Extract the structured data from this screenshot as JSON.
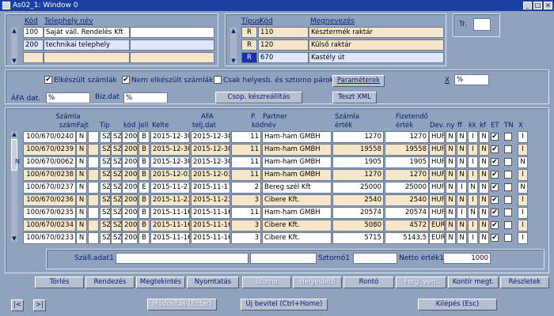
{
  "window": {
    "title": "As02_1: Window 0"
  },
  "telephely": {
    "headers": {
      "kod": "Kód",
      "nev": "Telephely név"
    },
    "rows": [
      {
        "kod": "100",
        "nev": "Saját váll. Rendelés Kft",
        "extra": ""
      },
      {
        "kod": "200",
        "nev": "technikai telephely",
        "extra": ""
      },
      {
        "kod": "",
        "nev": "",
        "extra": ""
      }
    ]
  },
  "raktar": {
    "headers": {
      "tipus": "Típus",
      "kod": "Kód",
      "megnevezes": "Megnevezés"
    },
    "rows": [
      {
        "tipus": "R",
        "kod": "110",
        "megnevezes": "Késztermék raktár"
      },
      {
        "tipus": "R",
        "kod": "120",
        "megnevezes": "Külső raktár"
      },
      {
        "tipus": "R",
        "kod": "670",
        "megnevezes": "Kastély út"
      }
    ]
  },
  "tr": {
    "label": "Tr.",
    "value": ""
  },
  "filters": {
    "elkeszult": {
      "label": "Elkészült számlák",
      "checked": "✔"
    },
    "nem_elkeszult": {
      "label": "Nem elkészült számlák",
      "checked": "✔"
    },
    "csak_helyesb": {
      "label": "Csak helyesb. és sztorno párok",
      "checked": ""
    },
    "parameterek_label": "Paraméterek",
    "x_label": "X",
    "x_value": "%",
    "afa_dat_label": "ÁFA dat.",
    "afa_dat_value": "%",
    "biz_dat_label": "Biz.dat",
    "biz_dat_value": "%",
    "csop_label": "Csop. készreállítás",
    "teszt_xml_label": "Teszt XML"
  },
  "grid": {
    "headers": {
      "szamla_szam_1": "Számla",
      "szamla_szam_2": "szám",
      "fajta": "Fajt",
      "tip": "Tip",
      "kod": "kód",
      "jell": "Jell",
      "kelte": "Kelte",
      "afa_1": "AFA",
      "afa_2": "telj.dat",
      "p_1": "P.",
      "p_2": "kódnév",
      "partner": "Partner",
      "szertek_1": "Számla",
      "szertek_2": "érték",
      "fiz_1": "Fizetendő",
      "fiz_2": "érték",
      "dev": "Dev.",
      "ny": "ny",
      "ff": "ff",
      "kk": "kk",
      "kf": "kf",
      "et": "ET",
      "tn": "TN",
      "x": "X"
    },
    "rows": [
      {
        "mark": "",
        "szam": "100/670/0240",
        "fajta": "N",
        "b": "",
        "tip": "SZ",
        "tip2": "SZ",
        "kod": "200",
        "jell": "B",
        "kelte": "2015-12-30",
        "afa": "2015-12-30",
        "p": "11",
        "partner": "Ham-ham GMBH",
        "ertek": "1270",
        "fiz": "1270",
        "dev": "HUF",
        "ny": "N",
        "ff": "N",
        "kk": "I",
        "kf": "N",
        "et": "✔",
        "tn": "",
        "x": "I"
      },
      {
        "mark": "",
        "szam": "100/670/0239",
        "fajta": "N",
        "b": "",
        "tip": "SZ",
        "tip2": "SZ",
        "kod": "200",
        "jell": "B",
        "kelte": "2015-12-30",
        "afa": "2015-12-30",
        "p": "11",
        "partner": "Ham-ham GMBH",
        "ertek": "19558",
        "fiz": "19558",
        "dev": "HUF",
        "ny": "N",
        "ff": "N",
        "kk": "I",
        "kf": "N",
        "et": "✔",
        "tn": "",
        "x": "I"
      },
      {
        "mark": "N",
        "szam": "100/670/0062",
        "fajta": "N",
        "b": "",
        "tip": "SZ",
        "tip2": "SZ",
        "kod": "200",
        "jell": "B",
        "kelte": "2015-12-30",
        "afa": "2015-12-30",
        "p": "11",
        "partner": "Ham-ham GMBH",
        "ertek": "1905",
        "fiz": "1905",
        "dev": "HUF",
        "ny": "N",
        "ff": "N",
        "kk": "I",
        "kf": "N",
        "et": "✔",
        "tn": "",
        "x": "N"
      },
      {
        "mark": "",
        "szam": "100/670/0238",
        "fajta": "N",
        "b": "",
        "tip": "SZ",
        "tip2": "SZ",
        "kod": "200",
        "jell": "B",
        "kelte": "2015-12-03",
        "afa": "2015-12-03",
        "p": "11",
        "partner": "Ham-ham GMBH",
        "ertek": "1270",
        "fiz": "1270",
        "dev": "HUF",
        "ny": "N",
        "ff": "N",
        "kk": "I",
        "kf": "N",
        "et": "✔",
        "tn": "",
        "x": "I"
      },
      {
        "mark": "",
        "szam": "100/670/0237",
        "fajta": "N",
        "b": "",
        "tip": "SZ",
        "tip2": "SZ",
        "kod": "200",
        "jell": "E",
        "kelte": "2015-11-27",
        "afa": "2015-11-17",
        "p": "2",
        "partner": "Bereg szél Kft",
        "ertek": "25000",
        "fiz": "25000",
        "dev": "HUF",
        "ny": "N",
        "ff": "I",
        "kk": "N",
        "kf": "N",
        "et": "✔",
        "tn": "",
        "x": "N"
      },
      {
        "mark": "",
        "szam": "100/670/0236",
        "fajta": "N",
        "b": "",
        "tip": "SZ",
        "tip2": "SZ",
        "kod": "200",
        "jell": "B",
        "kelte": "2015-11-23",
        "afa": "2015-11-23",
        "p": "3",
        "partner": "Cibere Kft.",
        "ertek": "2540",
        "fiz": "2540",
        "dev": "HUF",
        "ny": "N",
        "ff": "N",
        "kk": "I",
        "kf": "N",
        "et": "✔",
        "tn": "",
        "x": "I"
      },
      {
        "mark": "",
        "szam": "100/670/0235",
        "fajta": "N",
        "b": "",
        "tip": "SZ",
        "tip2": "SZ",
        "kod": "200",
        "jell": "B",
        "kelte": "2015-11-16",
        "afa": "2015-11-16",
        "p": "11",
        "partner": "Ham-ham GMBH",
        "ertek": "20574",
        "fiz": "20574",
        "dev": "HUF",
        "ny": "N",
        "ff": "I",
        "kk": "N",
        "kf": "N",
        "et": "✔",
        "tn": "",
        "x": "I"
      },
      {
        "mark": "",
        "szam": "100/670/0234",
        "fajta": "N",
        "b": "",
        "tip": "SZ",
        "tip2": "SZ",
        "kod": "200",
        "jell": "B",
        "kelte": "2015-11-16",
        "afa": "2015-11-16",
        "p": "3",
        "partner": "Cibere Kft.",
        "ertek": "5080",
        "fiz": "4572",
        "dev": "EUR",
        "ny": "N",
        "ff": "N",
        "kk": "I",
        "kf": "N",
        "et": "✔",
        "tn": "",
        "x": "I"
      },
      {
        "mark": "",
        "szam": "100/670/0233",
        "fajta": "N",
        "b": "",
        "tip": "SZ",
        "tip2": "SZ",
        "kod": "200",
        "jell": "B",
        "kelte": "2015-11-16",
        "afa": "2015-11-16",
        "p": "3",
        "partner": "Cibere Kft.",
        "ertek": "5715",
        "fiz": "5143,5",
        "dev": "EUR",
        "ny": "N",
        "ff": "N",
        "kk": "I",
        "kf": "N",
        "et": "✔",
        "tn": "",
        "x": "I"
      }
    ]
  },
  "footer_info": {
    "szall_label": "Száll.adat1",
    "szall_value": "",
    "szall_value2": "",
    "sztorno_label": "Sztornó1",
    "sztorno_value": "",
    "netto_label": "Netto érték1",
    "netto_value": "1000"
  },
  "actions": {
    "torles": "Törlés",
    "rendezes": "Rendezés",
    "megtekintes": "Megtekintés",
    "nyomtatas": "Nyomtatás",
    "storno": "Storno",
    "helyesbito": "Helyesbítő",
    "ronto": "Rontó",
    "forg_ven": "Forg. ven.",
    "kontir": "Kontír megt.",
    "reszletek": "Részletek"
  },
  "bottom": {
    "first": "|<",
    "last": ">|",
    "modositas": "Módosítás (Enter)",
    "uj_bevitel": "Új bevitel (Ctrl+Home)",
    "kilepes": "Kilépés (Esc)"
  }
}
